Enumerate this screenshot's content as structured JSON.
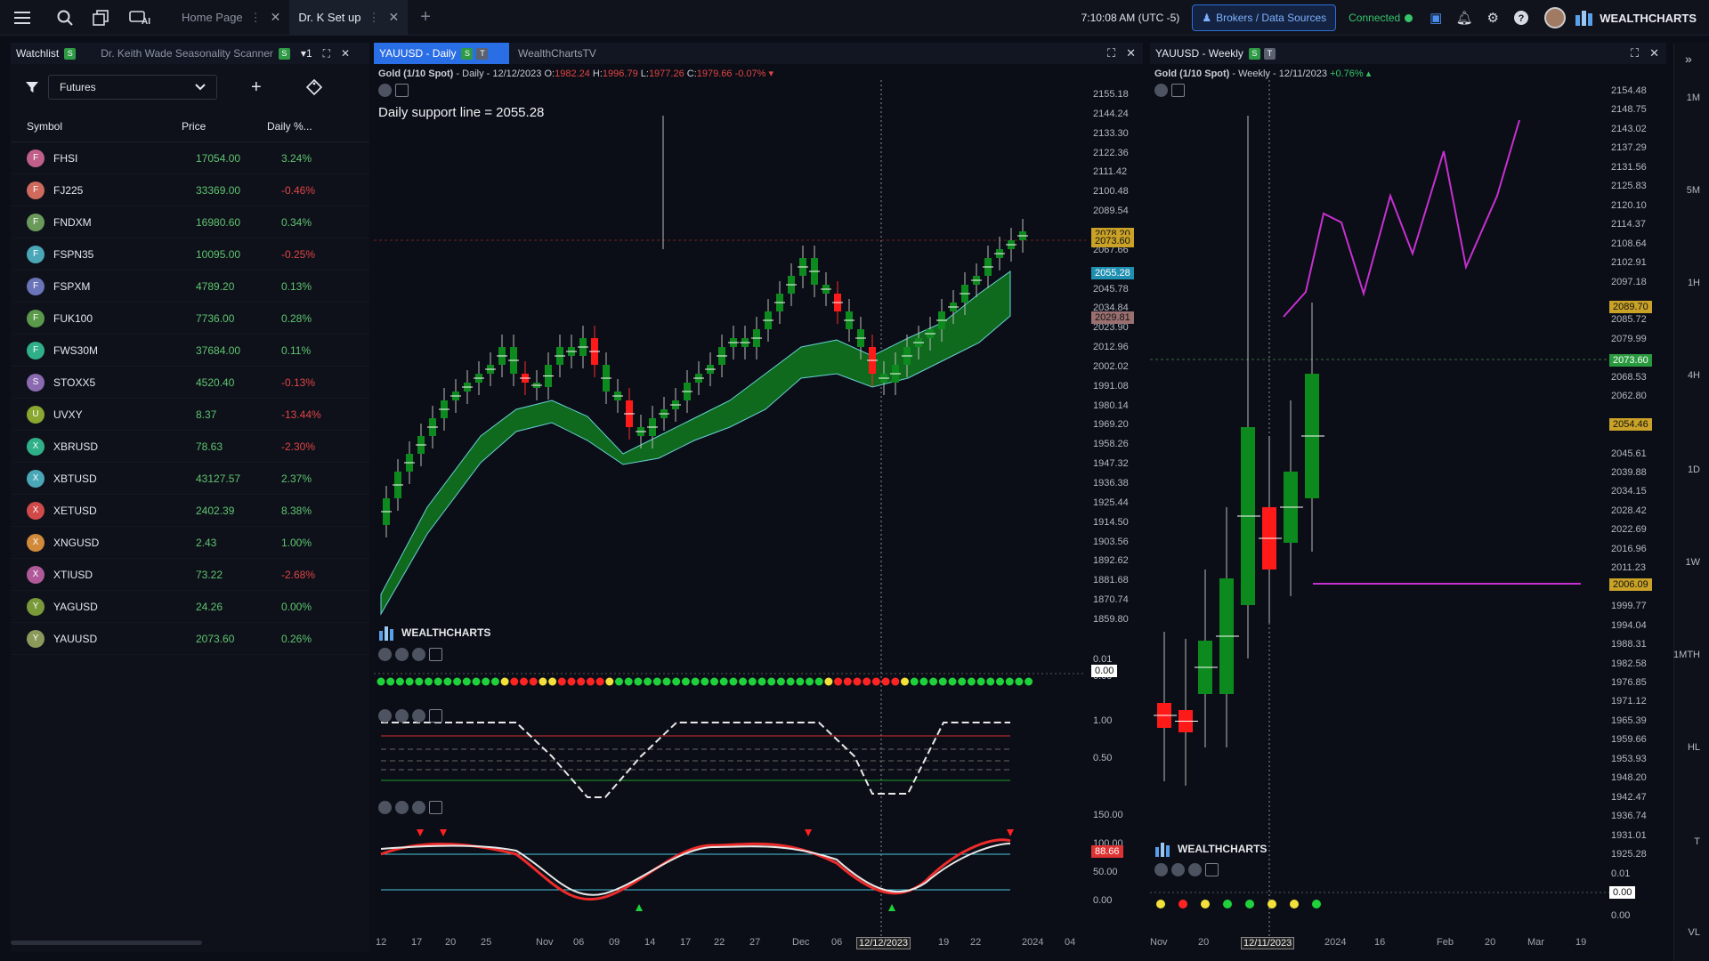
{
  "topbar": {
    "tabs": [
      {
        "label": "Home Page",
        "active": false
      },
      {
        "label": "Dr. K Set up",
        "active": true
      }
    ],
    "clock": "7:10:08 AM",
    "timezone": "(UTC -5)",
    "brokers_label": "Brokers / Data Sources",
    "status": "Connected",
    "brand": "WEALTHCHARTS",
    "ai_label": "AI"
  },
  "watchlist": {
    "tab_label": "Watchlist",
    "scanner_label": "Dr. Keith Wade Seasonality Scanner",
    "tab_count": "1",
    "filter_value": "Futures",
    "columns": {
      "symbol": "Symbol",
      "price": "Price",
      "daily": "Daily %..."
    },
    "rows": [
      {
        "letter": "F",
        "symbol": "FHSI",
        "price": "17054.00",
        "pct": "3.24%",
        "up": true,
        "color": "#c0608a"
      },
      {
        "letter": "F",
        "symbol": "FJ225",
        "price": "33369.00",
        "pct": "-0.46%",
        "up": false,
        "color": "#d06a5c"
      },
      {
        "letter": "F",
        "symbol": "FNDXM",
        "price": "16980.60",
        "pct": "0.34%",
        "up": true,
        "color": "#6a9a5a"
      },
      {
        "letter": "F",
        "symbol": "FSPN35",
        "price": "10095.00",
        "pct": "-0.25%",
        "up": false,
        "color": "#4aa7b8"
      },
      {
        "letter": "F",
        "symbol": "FSPXM",
        "price": "4789.20",
        "pct": "0.13%",
        "up": true,
        "color": "#6a74b8"
      },
      {
        "letter": "F",
        "symbol": "FUK100",
        "price": "7736.00",
        "pct": "0.28%",
        "up": true,
        "color": "#5a9a4a"
      },
      {
        "letter": "F",
        "symbol": "FWS30M",
        "price": "37684.00",
        "pct": "0.11%",
        "up": true,
        "color": "#2fb088"
      },
      {
        "letter": "S",
        "symbol": "STOXX5",
        "price": "4520.40",
        "pct": "-0.13%",
        "up": false,
        "color": "#8a6ab0"
      },
      {
        "letter": "U",
        "symbol": "UVXY",
        "price": "8.37",
        "pct": "-13.44%",
        "up": false,
        "color": "#8aa830"
      },
      {
        "letter": "X",
        "symbol": "XBRUSD",
        "price": "78.63",
        "pct": "-2.30%",
        "up": false,
        "color": "#2fb088"
      },
      {
        "letter": "X",
        "symbol": "XBTUSD",
        "price": "43127.57",
        "pct": "2.37%",
        "up": true,
        "color": "#4aa7b8"
      },
      {
        "letter": "X",
        "symbol": "XETUSD",
        "price": "2402.39",
        "pct": "8.38%",
        "up": true,
        "color": "#d04a4a"
      },
      {
        "letter": "X",
        "symbol": "XNGUSD",
        "price": "2.43",
        "pct": "1.00%",
        "up": true,
        "color": "#d08a3a"
      },
      {
        "letter": "X",
        "symbol": "XTIUSD",
        "price": "73.22",
        "pct": "-2.68%",
        "up": false,
        "color": "#b05a9a"
      },
      {
        "letter": "Y",
        "symbol": "YAGUSD",
        "price": "24.26",
        "pct": "0.00%",
        "up": true,
        "color": "#7a9a3a"
      },
      {
        "letter": "Y",
        "symbol": "YAUUSD",
        "price": "2073.60",
        "pct": "0.26%",
        "up": true,
        "color": "#8a9a5a"
      }
    ]
  },
  "daily_chart": {
    "tab_label": "YAUUSD - Daily",
    "tab2_label": "WealthChartsTV",
    "title": "Gold (1/10 Spot)",
    "timeframe": "- Daily - 12/12/2023",
    "o_label": "O:",
    "o": "1982.24",
    "h_label": "H:",
    "h": "1996.79",
    "l_label": "L:",
    "l": "1977.26",
    "c_label": "C:",
    "c": "1979.66",
    "chg": "-0.07%",
    "annotation": "Daily support line = 2055.28",
    "y_labels": [
      "2155.18",
      "2144.24",
      "2133.30",
      "2122.36",
      "2111.42",
      "2100.48",
      "2089.54",
      "2067.66",
      "2045.78",
      "2034.84",
      "2023.90",
      "2012.96",
      "2002.02",
      "1991.08",
      "1980.14",
      "1969.20",
      "1958.26",
      "1947.32",
      "1936.38",
      "1925.44",
      "1914.50",
      "1903.56",
      "1892.62",
      "1881.68",
      "1870.74",
      "1859.80"
    ],
    "tags": [
      {
        "text": "2078.20",
        "bg": "#c9a227"
      },
      {
        "text": "2073.60",
        "bg": "#c9a227"
      },
      {
        "text": "2055.28",
        "bg": "#1f8fb0"
      },
      {
        "text": "2029.81",
        "bg": "#9a6f6f"
      }
    ],
    "osc1_labels": [
      "0.01",
      "0.00"
    ],
    "osc2_labels": [
      "1.00",
      "0.50"
    ],
    "osc3_labels": [
      "150.00",
      "100.00",
      "88.66",
      "50.00",
      "0.00"
    ],
    "x_labels": [
      "12",
      "17",
      "20",
      "25",
      "Nov",
      "06",
      "09",
      "14",
      "17",
      "22",
      "27",
      "Dec",
      "06",
      "12/12/2023",
      "19",
      "22",
      "2024",
      "04"
    ],
    "watermark": "WEALTHCHARTS"
  },
  "weekly_chart": {
    "tab_label": "YAUUSD - Weekly",
    "title": "Gold (1/10 Spot)",
    "timeframe": "- Weekly - 12/11/2023",
    "chg": "+0.76%",
    "y_labels": [
      "2154.48",
      "2148.75",
      "2143.02",
      "2137.29",
      "2131.56",
      "2125.83",
      "2120.10",
      "2114.37",
      "2108.64",
      "2102.91",
      "2097.18",
      "2085.72",
      "2079.99",
      "2068.53",
      "2062.80",
      "2045.61",
      "2039.88",
      "2034.15",
      "2028.42",
      "2022.69",
      "2016.96",
      "2011.23",
      "1999.77",
      "1994.04",
      "1988.31",
      "1982.58",
      "1976.85",
      "1971.12",
      "1965.39",
      "1959.66",
      "1953.93",
      "1948.20",
      "1942.47",
      "1936.74",
      "1931.01",
      "1925.28"
    ],
    "tags": [
      {
        "text": "2089.70",
        "bg": "#c9a227"
      },
      {
        "text": "2073.60",
        "bg": "#2a9a3f"
      },
      {
        "text": "2054.46",
        "bg": "#c9a227"
      },
      {
        "text": "2006.09",
        "bg": "#c9a227"
      }
    ],
    "osc_labels": [
      "0.01",
      "0.00",
      "0.00"
    ],
    "x_labels": [
      "Nov",
      "20",
      "12/11/2023",
      "2024",
      "16",
      "Feb",
      "20",
      "Mar",
      "19"
    ],
    "watermark": "WEALTHCHARTS"
  },
  "timeframes": [
    "1M",
    "5M",
    "1H",
    "4H",
    "1D",
    "1W",
    "1MTH",
    "HL",
    "T",
    "VL"
  ]
}
